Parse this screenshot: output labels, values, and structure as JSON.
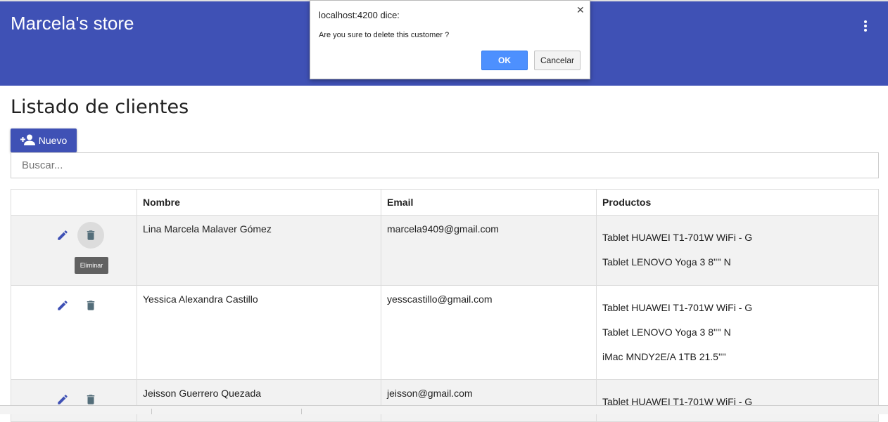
{
  "app": {
    "title": "Marcela's store",
    "menu_icon": "more-vert-icon",
    "colors": {
      "primary": "#3f51b5",
      "edit_icon": "#3f51b5",
      "delete_icon": "#546e7a"
    }
  },
  "page": {
    "title": "Listado de clientes",
    "new_button_label": "Nuevo",
    "new_button_icon": "person-add-icon",
    "search_placeholder": "Buscar..."
  },
  "table": {
    "columns": [
      "",
      "Nombre",
      "Email",
      "Productos"
    ],
    "rows": [
      {
        "name": "Lina Marcela Malaver Gómez",
        "email": "marcela9409@gmail.com",
        "products": [
          "Tablet HUAWEI T1-701W WiFi - G",
          "Tablet LENOVO Yoga 3 8'''' N"
        ]
      },
      {
        "name": "Yessica Alexandra Castillo",
        "email": "yesscastillo@gmail.com",
        "products": [
          "Tablet HUAWEI T1-701W WiFi - G",
          "Tablet LENOVO Yoga 3 8'''' N",
          "iMac MNDY2E/A 1TB 21.5''''"
        ]
      },
      {
        "name": "Jeisson Guerrero Quezada",
        "email": "jeisson@gmail.com",
        "products": [
          "Tablet HUAWEI T1-701W WiFi - G"
        ]
      }
    ],
    "tooltip": "Eliminar"
  },
  "dialog": {
    "title": "localhost:4200 dice:",
    "message": "Are you sure to delete this customer ?",
    "ok_label": "OK",
    "cancel_label": "Cancelar"
  }
}
